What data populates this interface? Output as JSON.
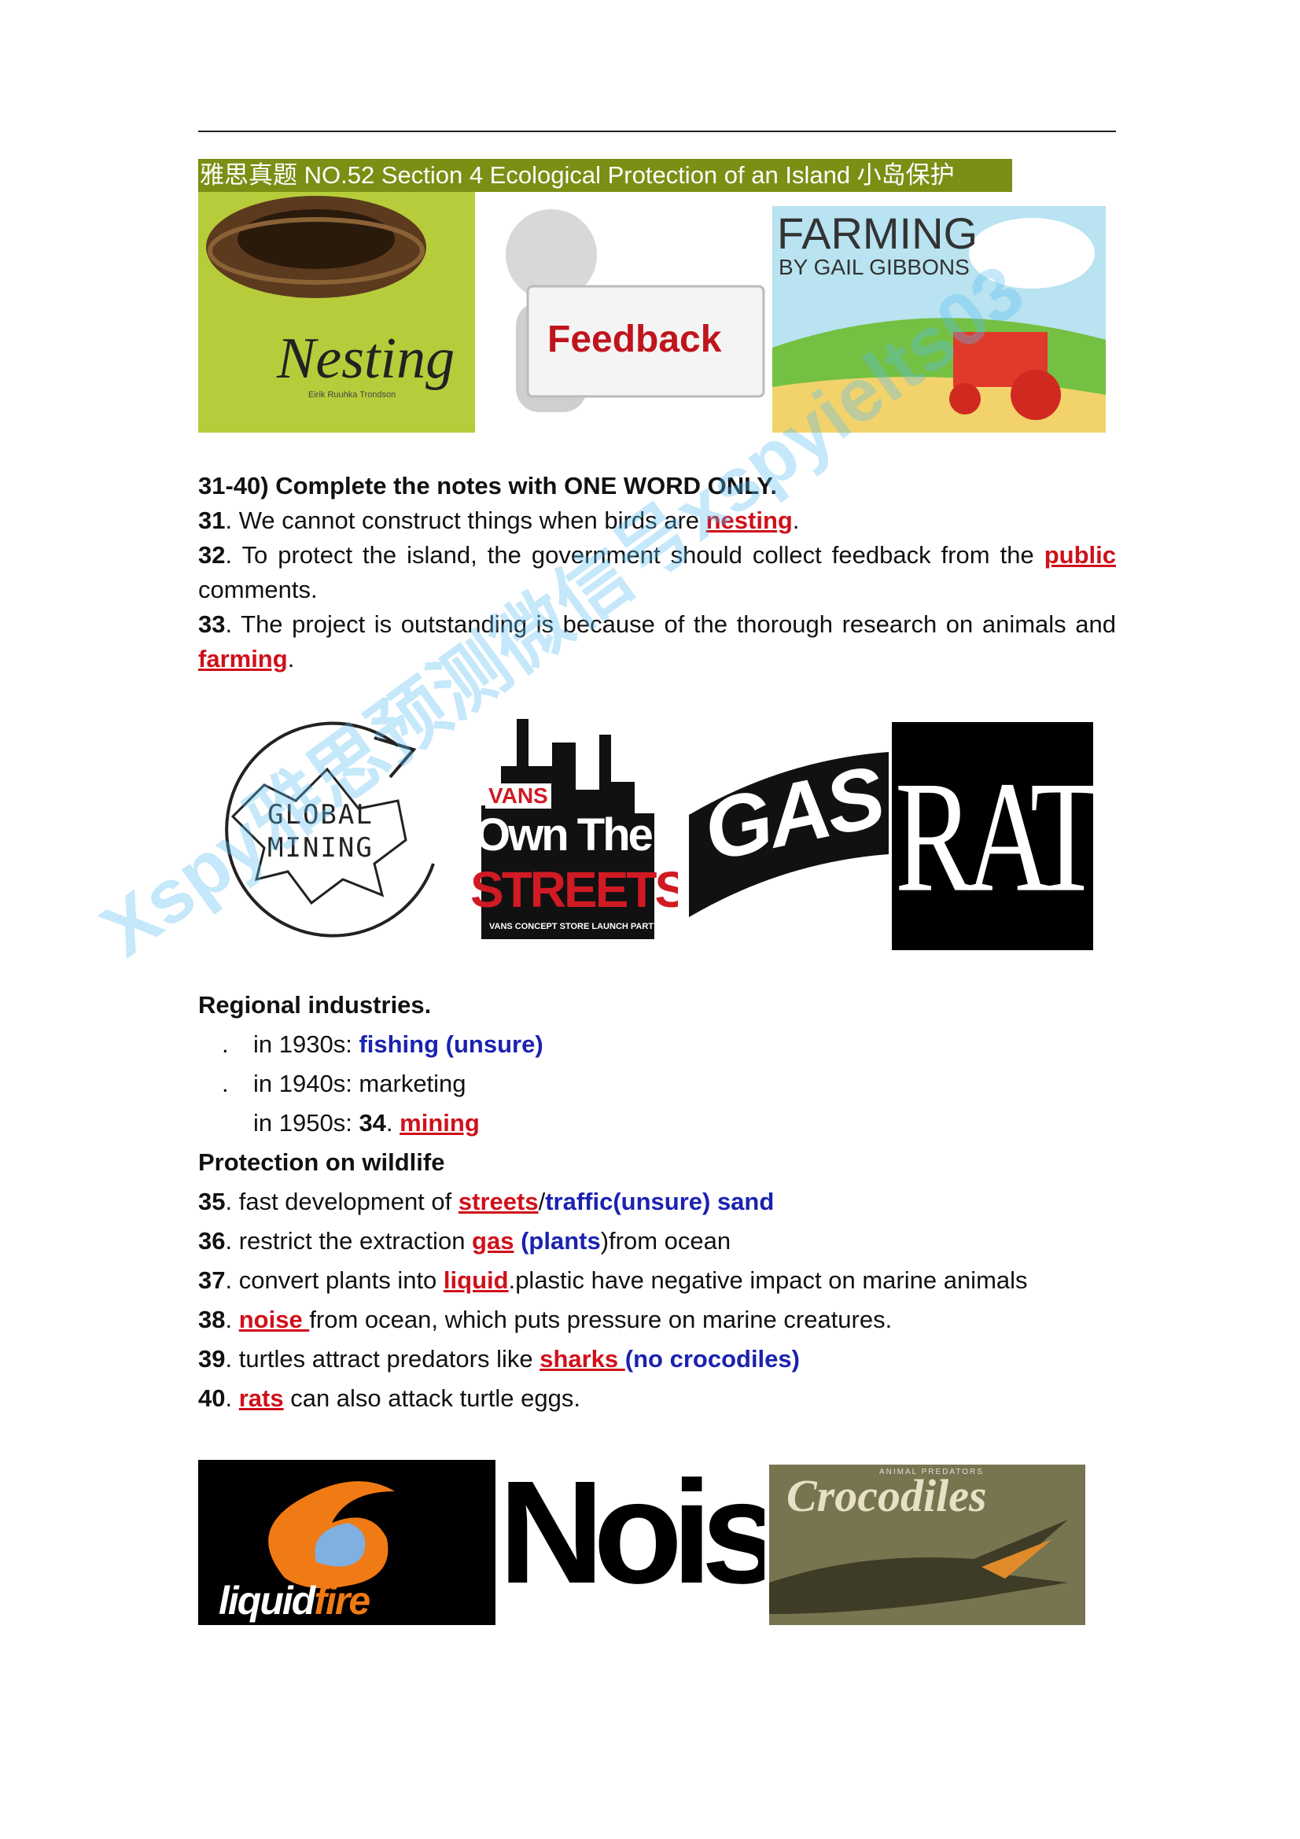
{
  "header": {
    "title": "雅思真题 NO.52 Section 4 Ecological Protection of an Island 小岛保护"
  },
  "images_row1": {
    "nesting": {
      "title": "Nesting",
      "subtitle": "Eirik Ruuhka Trondson"
    },
    "feedback": {
      "label": "Feedback"
    },
    "farming": {
      "title": "FARMING",
      "byline": "BY GAIL GIBBONS"
    }
  },
  "questions": {
    "instruction": "31-40) Complete the notes with ONE WORD ONLY.",
    "q31": {
      "num": "31",
      "text": ". We cannot construct things when birds are ",
      "answer": "nesting",
      "end": "."
    },
    "q32": {
      "num": "32",
      "text": ". To protect the island, the government should collect feedback from the ",
      "answer": "public",
      "cont": "comments."
    },
    "q33": {
      "num": "33",
      "text": ". The project is outstanding is because of the thorough research on animals and",
      "answer": "farming",
      "end": "."
    }
  },
  "images_row2": {
    "global_mining": {
      "line1": "GLOBAL",
      "line2": "MINING"
    },
    "vans": {
      "brand": "VANS",
      "line1": "Own The",
      "line2": "STREETS",
      "small": "VANS CONCEPT STORE LAUNCH PARTY"
    },
    "gas": {
      "label": "GAS"
    },
    "rats": {
      "label": "RATS"
    }
  },
  "regional": {
    "heading": "Regional industries.",
    "bullet": ".",
    "r1930_label": "in 1930s: ",
    "r1930_value": "fishing (unsure)",
    "r1940_label": "in 1940s: marketing",
    "r1950_label": "in 1950s: ",
    "r1950_num": "34",
    "r1950_dot": ". ",
    "r1950_answer": "mining"
  },
  "wildlife": {
    "heading": "Protection on wildlife",
    "q35": {
      "num": "35",
      "text": ". fast development of ",
      "answer": "streets",
      "slash": "/",
      "alt": "traffic(unsure) sand"
    },
    "q36": {
      "num": "36",
      "text": ". restrict the extraction ",
      "answer": "gas",
      "alt": " (plants",
      "tail": ")from ocean"
    },
    "q37": {
      "num": "37",
      "text": ". convert plants into ",
      "answer": "liquid",
      "tail": ".plastic have negative impact on marine animals"
    },
    "q38": {
      "num": "38",
      "text": ". ",
      "answer": "noise ",
      "tail": "from ocean, which puts pressure on marine creatures."
    },
    "q39": {
      "num": "39",
      "text": ". turtles attract predators like ",
      "answer": "sharks ",
      "alt": "(no crocodiles)"
    },
    "q40": {
      "num": "40",
      "text": ". ",
      "answer": "rats",
      "tail": " can also attack turtle eggs."
    }
  },
  "images_row3": {
    "liquidfire": {
      "part1": "liquid",
      "part2": "fire"
    },
    "noise": {
      "label": "Noise"
    },
    "crocodiles": {
      "label": "Crocodiles",
      "small": "ANIMAL PREDATORS"
    }
  },
  "watermark": {
    "text": "Xspy雅思预测微信号xspyielts03"
  },
  "colors": {
    "answer_red": "#d0101a",
    "unsure_blue": "#1a22b0",
    "title_bar": "#7a8f14"
  }
}
